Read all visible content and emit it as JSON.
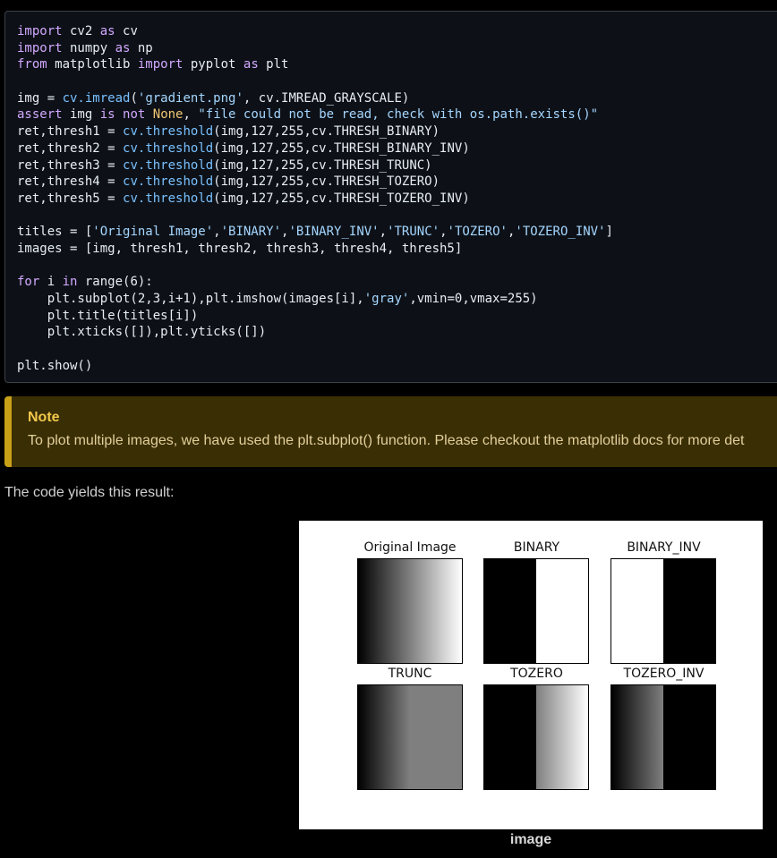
{
  "code": {
    "lines": [
      "import cv2 as cv",
      "import numpy as np",
      "from matplotlib import pyplot as plt",
      "",
      "img = cv.imread('gradient.png', cv.IMREAD_GRAYSCALE)",
      "assert img is not None, \"file could not be read, check with os.path.exists()\"",
      "ret,thresh1 = cv.threshold(img,127,255,cv.THRESH_BINARY)",
      "ret,thresh2 = cv.threshold(img,127,255,cv.THRESH_BINARY_INV)",
      "ret,thresh3 = cv.threshold(img,127,255,cv.THRESH_TRUNC)",
      "ret,thresh4 = cv.threshold(img,127,255,cv.THRESH_TOZERO)",
      "ret,thresh5 = cv.threshold(img,127,255,cv.THRESH_TOZERO_INV)",
      "",
      "titles = ['Original Image','BINARY','BINARY_INV','TRUNC','TOZERO','TOZERO_INV']",
      "images = [img, thresh1, thresh2, thresh3, thresh4, thresh5]",
      "",
      "for i in range(6):",
      "    plt.subplot(2,3,i+1),plt.imshow(images[i],'gray',vmin=0,vmax=255)",
      "    plt.title(titles[i])",
      "    plt.xticks([]),plt.yticks([])",
      "",
      "plt.show()"
    ]
  },
  "note": {
    "title": "Note",
    "text": "To plot multiple images, we have used the plt.subplot() function. Please checkout the matplotlib docs for more det"
  },
  "result_text": "The code yields this result:",
  "figure": {
    "panels": [
      {
        "title": "Original Image",
        "kind": "gradient"
      },
      {
        "title": "BINARY",
        "kind": "binary"
      },
      {
        "title": "BINARY_INV",
        "kind": "binary_inv"
      },
      {
        "title": "TRUNC",
        "kind": "trunc"
      },
      {
        "title": "TOZERO",
        "kind": "tozero"
      },
      {
        "title": "TOZERO_INV",
        "kind": "tozero_inv"
      }
    ],
    "caption": "image"
  },
  "colors": {
    "code_bg": "#0d1117",
    "note_bg": "#3a2e05",
    "note_accent": "#c8a018",
    "note_title": "#f2c94c"
  }
}
